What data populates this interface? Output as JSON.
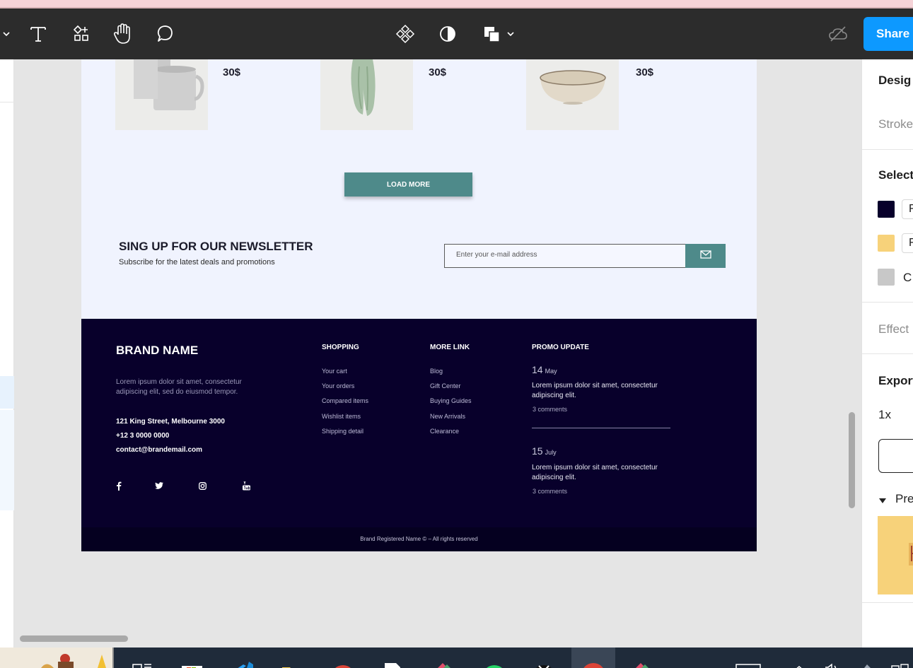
{
  "toolbar": {
    "tools": [
      "text-tool",
      "components-tool",
      "hand-tool",
      "comment-tool"
    ],
    "center_tools": [
      "component-icon",
      "contrast-icon",
      "boolean-icon"
    ],
    "share_label": "Share"
  },
  "canvas": {
    "products": [
      {
        "price": "30$",
        "image": "mugs"
      },
      {
        "price": "30$",
        "image": "fabric"
      },
      {
        "price": "30$",
        "image": "bowl"
      }
    ],
    "load_more": "LOAD MORE",
    "newsletter": {
      "title": "SING UP FOR OUR NEWSLETTER",
      "subtitle": "Subscribe for the latest deals and promotions",
      "placeholder": "Enter your e-mail address"
    },
    "footer": {
      "brand": "BRAND NAME",
      "description": "Lorem ipsum dolor sit amet, consectetur adipiscing elit, sed do eiusmod tempor.",
      "address": "121 King Street, Melbourne 3000",
      "phone": "+12 3 0000 0000",
      "email": "contact@brandemail.com",
      "social": [
        "facebook-icon",
        "twitter-icon",
        "instagram-icon",
        "youtube-icon"
      ],
      "shopping": {
        "title": "SHOPPING",
        "items": [
          "Your cart",
          "Your orders",
          "Compared items",
          "Wishlist items",
          "Shipping detail"
        ]
      },
      "more_link": {
        "title": "MORE LINK",
        "items": [
          "Blog",
          "Gift Center",
          "Buying Guides",
          "New Arrivals",
          "Clearance"
        ]
      },
      "promo": {
        "title": "PROMO UPDATE",
        "entries": [
          {
            "day": "14",
            "month": "May",
            "text": "Lorem ipsum dolor sit amet, consectetur adipiscing elit.",
            "comments": "3 comments"
          },
          {
            "day": "15",
            "month": "July",
            "text": "Lorem ipsum dolor sit amet, consectetur adipiscing elit.",
            "comments": "3 comments"
          }
        ]
      },
      "copyright": "Brand Registered Name © – All rights reserved"
    }
  },
  "right_panel": {
    "design": "Desig",
    "stroke": "Stroke",
    "selection": "Select",
    "colors": [
      {
        "hex": "#08002b",
        "chip": "F"
      },
      {
        "hex": "#f7d27a",
        "chip": "F"
      },
      {
        "hex": "#c8c8c8",
        "label": "C"
      }
    ],
    "effects": "Effect",
    "export": "Export",
    "scale": "1x",
    "preview": "Pre"
  },
  "colors": {
    "accent": "#0d99ff",
    "teal": "#4e8a8a",
    "footer_bg": "#08002b"
  }
}
